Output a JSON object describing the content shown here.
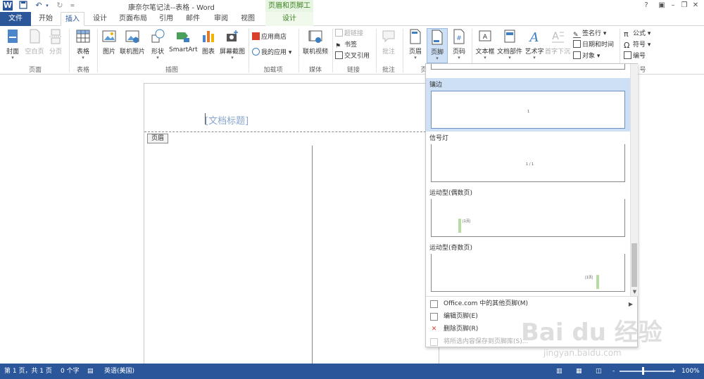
{
  "title_bar": {
    "document_title": "康奈尔笔记法--表格 - Word",
    "contextual_group": "页眉和页脚工具",
    "qat": [
      "word-logo-icon",
      "save-icon",
      "undo-icon",
      "redo-icon",
      "customize-qat-icon"
    ]
  },
  "tabs": {
    "file": "文件",
    "home": "开始",
    "insert": "插入",
    "design": "设计",
    "layout": "页面布局",
    "references": "引用",
    "mailings": "邮件",
    "review": "审阅",
    "view": "视图",
    "hf_design": "设计"
  },
  "ribbon": {
    "pages": {
      "label": "页面",
      "cover": "封面",
      "blank": "空白页",
      "break": "分页"
    },
    "tables": {
      "label": "表格",
      "table": "表格"
    },
    "illustrations": {
      "label": "插图",
      "pictures": "图片",
      "online_pictures": "联机图片",
      "shapes": "形状",
      "smartart": "SmartArt",
      "chart": "图表",
      "screenshot": "屏幕截图"
    },
    "addins": {
      "label": "加载项",
      "store": "应用商店",
      "my_apps": "我的应用"
    },
    "media": {
      "label": "媒体",
      "online_video": "联机视频"
    },
    "links": {
      "label": "链接",
      "hyperlink": "超链接",
      "bookmark": "书签",
      "cross_ref": "交叉引用"
    },
    "comments": {
      "label": "批注",
      "comment": "批注"
    },
    "header_footer": {
      "label": "页",
      "header": "页眉",
      "footer": "页脚",
      "page_number": "页码"
    },
    "text": {
      "textbox": "文本框",
      "quick_parts": "文档部件",
      "wordart": "艺术字",
      "dropcap": "首字下沉",
      "signature": "签名行",
      "datetime": "日期和时间",
      "object": "对象"
    },
    "symbols": {
      "label": "号",
      "equation": "公式",
      "symbol": "符号",
      "number": "编号"
    }
  },
  "document": {
    "title_placeholder": "[文档标题]",
    "header_tag": "页眉"
  },
  "footer_gallery": {
    "items": [
      "镶边",
      "信号灯",
      "运动型(偶数页)",
      "运动型(奇数页)"
    ],
    "thumb_texts": [
      "1",
      "1 / 1",
      "|1页|",
      "|1页|"
    ],
    "selected_index": 0,
    "accent_bar_color": "#b6dca3",
    "selection_color": "#cde0f5"
  },
  "footer_menu": {
    "more_online": "Office.com 中的其他页脚(M)",
    "edit": "编辑页脚(E)",
    "remove": "删除页脚(R)",
    "save_selection": "将所选内容保存到页脚库(S)..."
  },
  "status_bar": {
    "page": "第 1 页，共 1 页",
    "words": "0 个字",
    "language": "英语(美国)",
    "zoom": "100%",
    "zoom_minus": "-",
    "zoom_plus": "+",
    "color": "#2b579a"
  },
  "watermark": {
    "logo": "Bai du 经验",
    "url": "jingyan.baidu.com"
  }
}
